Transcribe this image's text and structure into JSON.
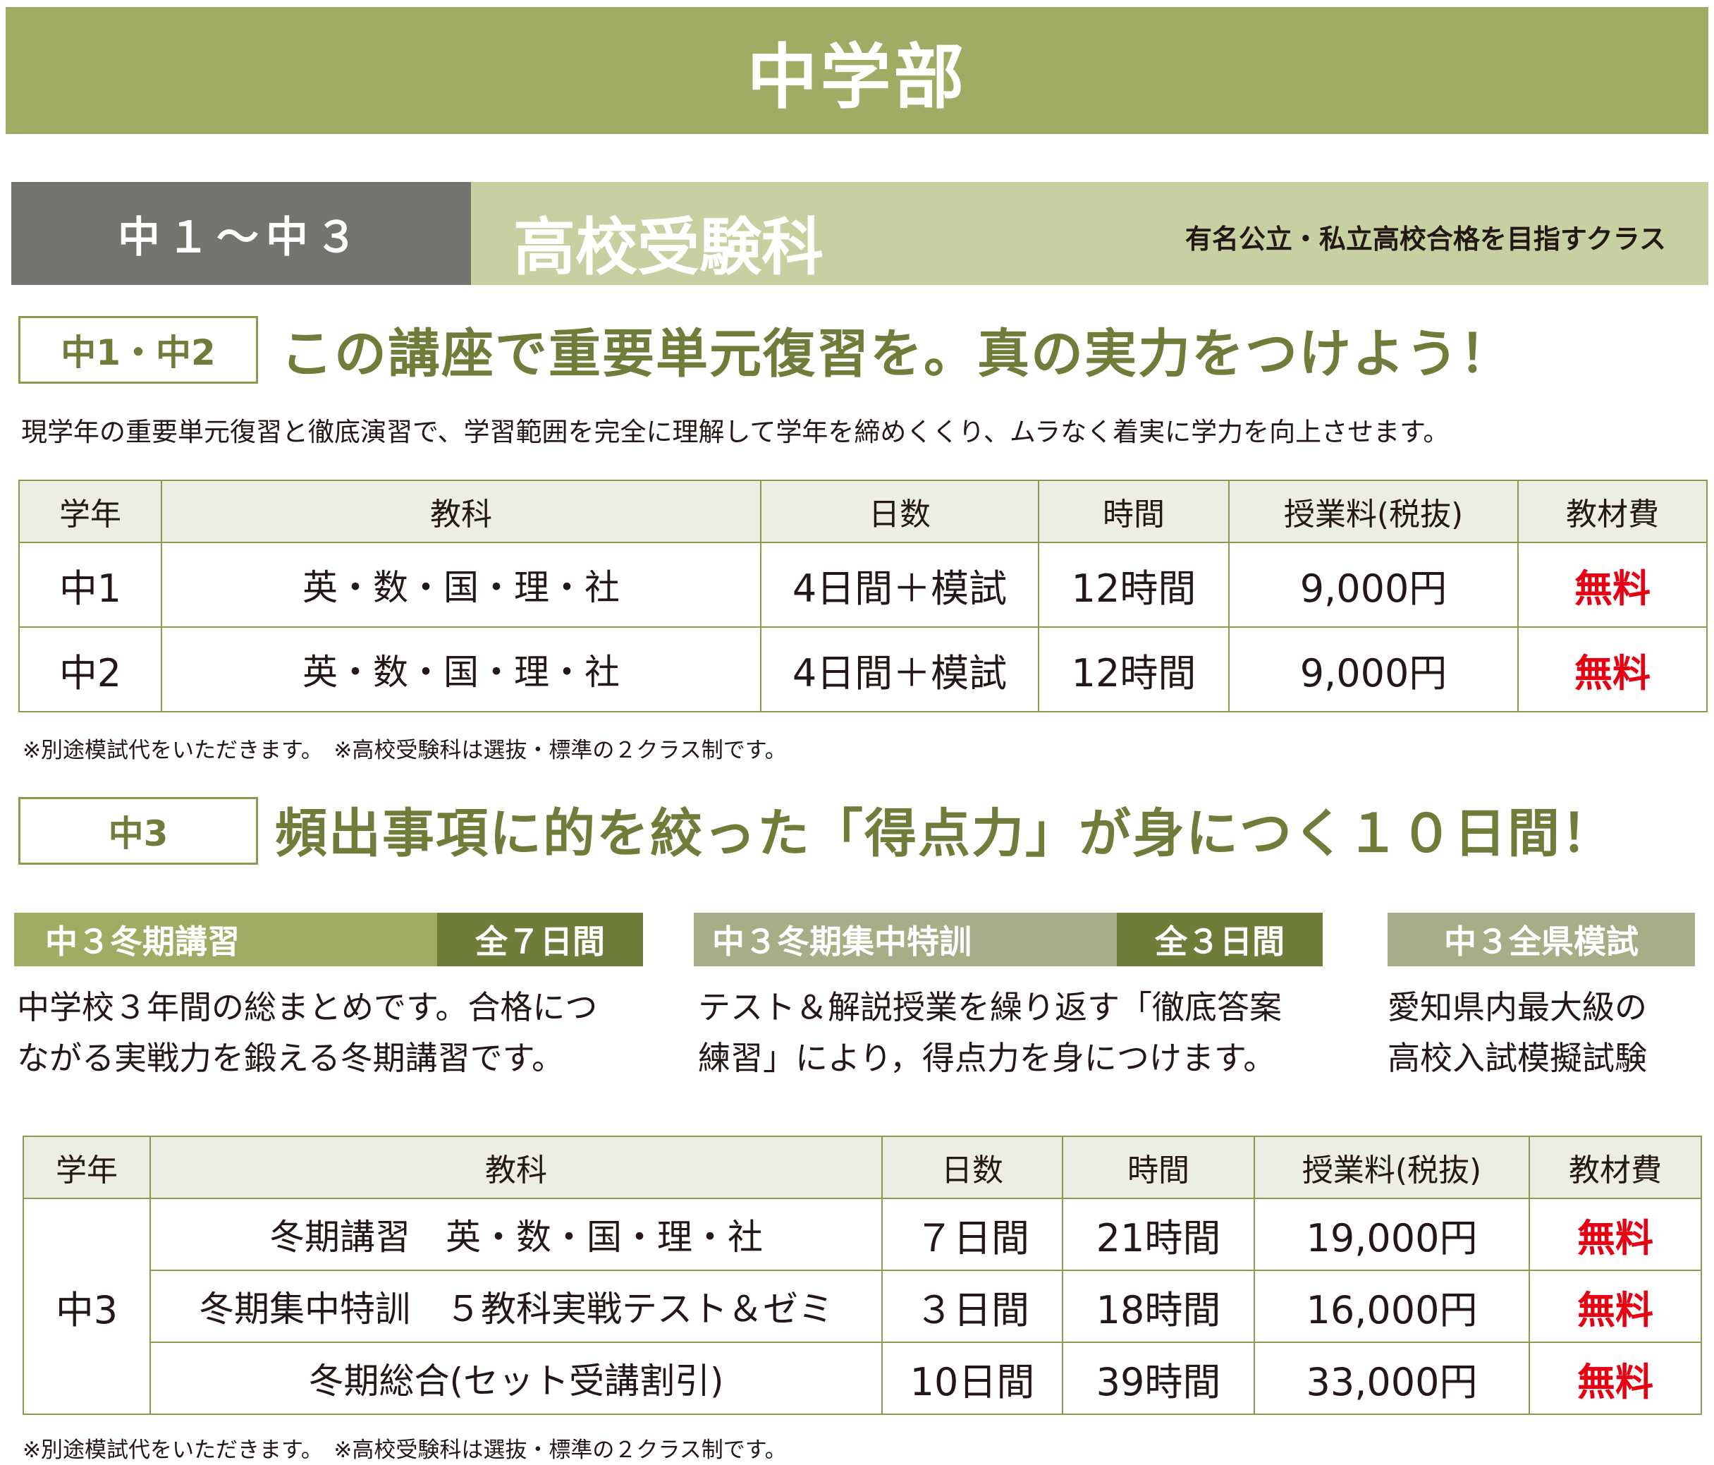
{
  "banner": {
    "title": "中学部"
  },
  "section": {
    "grade_range": "中１～中３",
    "course": "高校受験科",
    "course_subtitle": "有名公立・私立高校合格を目指すクラス"
  },
  "part1": {
    "label": "中1・中2",
    "headline": "この講座で重要単元復習を。真の実力をつけよう！",
    "description": "現学年の重要単元復習と徹底演習で、学習範囲を完全に理解して学年を締めくくり、ムラなく着実に学力を向上させます。",
    "table": {
      "headers": [
        "学年",
        "教科",
        "日数",
        "時間",
        "授業料(税抜)",
        "教材費"
      ],
      "rows": [
        {
          "grade": "中1",
          "subjects": "英・数・国・理・社",
          "days": "4日間＋模試",
          "hours": "12時間",
          "fee": "9,000円",
          "materials": "無料"
        },
        {
          "grade": "中2",
          "subjects": "英・数・国・理・社",
          "days": "4日間＋模試",
          "hours": "12時間",
          "fee": "9,000円",
          "materials": "無料"
        }
      ]
    },
    "note": "※別途模試代をいただきます。　※高校受験科は選抜・標準の２クラス制です。"
  },
  "part2": {
    "label": "中3",
    "headline": "頻出事項に的を絞った「得点力」が身につく１０日間！",
    "courses": [
      {
        "name": "中３冬期講習",
        "duration": "全７日間",
        "text": [
          "中学校３年間の総まとめです。合格につ",
          "ながる実戦力を鍛える冬期講習です。"
        ]
      },
      {
        "name": "中３冬期集中特訓",
        "duration": "全３日間",
        "text": [
          "テスト＆解説授業を繰り返す「徹底答案",
          "練習」により，得点力を身につけます。"
        ]
      },
      {
        "name": "中３全県模試",
        "duration": "",
        "text": [
          "愛知県内最大級の",
          "高校入試模擬試験"
        ]
      }
    ],
    "table": {
      "headers": [
        "学年",
        "教科",
        "日数",
        "時間",
        "授業料(税抜)",
        "教材費"
      ],
      "grade": "中3",
      "rows": [
        {
          "subjects": "冬期講習　英・数・国・理・社",
          "days": "７日間",
          "hours": "21時間",
          "fee": "19,000円",
          "materials": "無料"
        },
        {
          "subjects": "冬期集中特訓　５教科実戦テスト＆ゼミ",
          "days": "３日間",
          "hours": "18時間",
          "fee": "16,000円",
          "materials": "無料"
        },
        {
          "subjects": "冬期総合(セット受講割引)",
          "days": "10日間",
          "hours": "39時間",
          "fee": "33,000円",
          "materials": "無料"
        }
      ]
    },
    "note": "※別途模試代をいただきます。　※高校受験科は選抜・標準の２クラス制です。"
  },
  "colors": {
    "olive": "#a2ab63",
    "dark_olive": "#6f7d3a",
    "gray": "#73746e",
    "light_olive": "#c7d0a1",
    "red": "#e60012"
  }
}
